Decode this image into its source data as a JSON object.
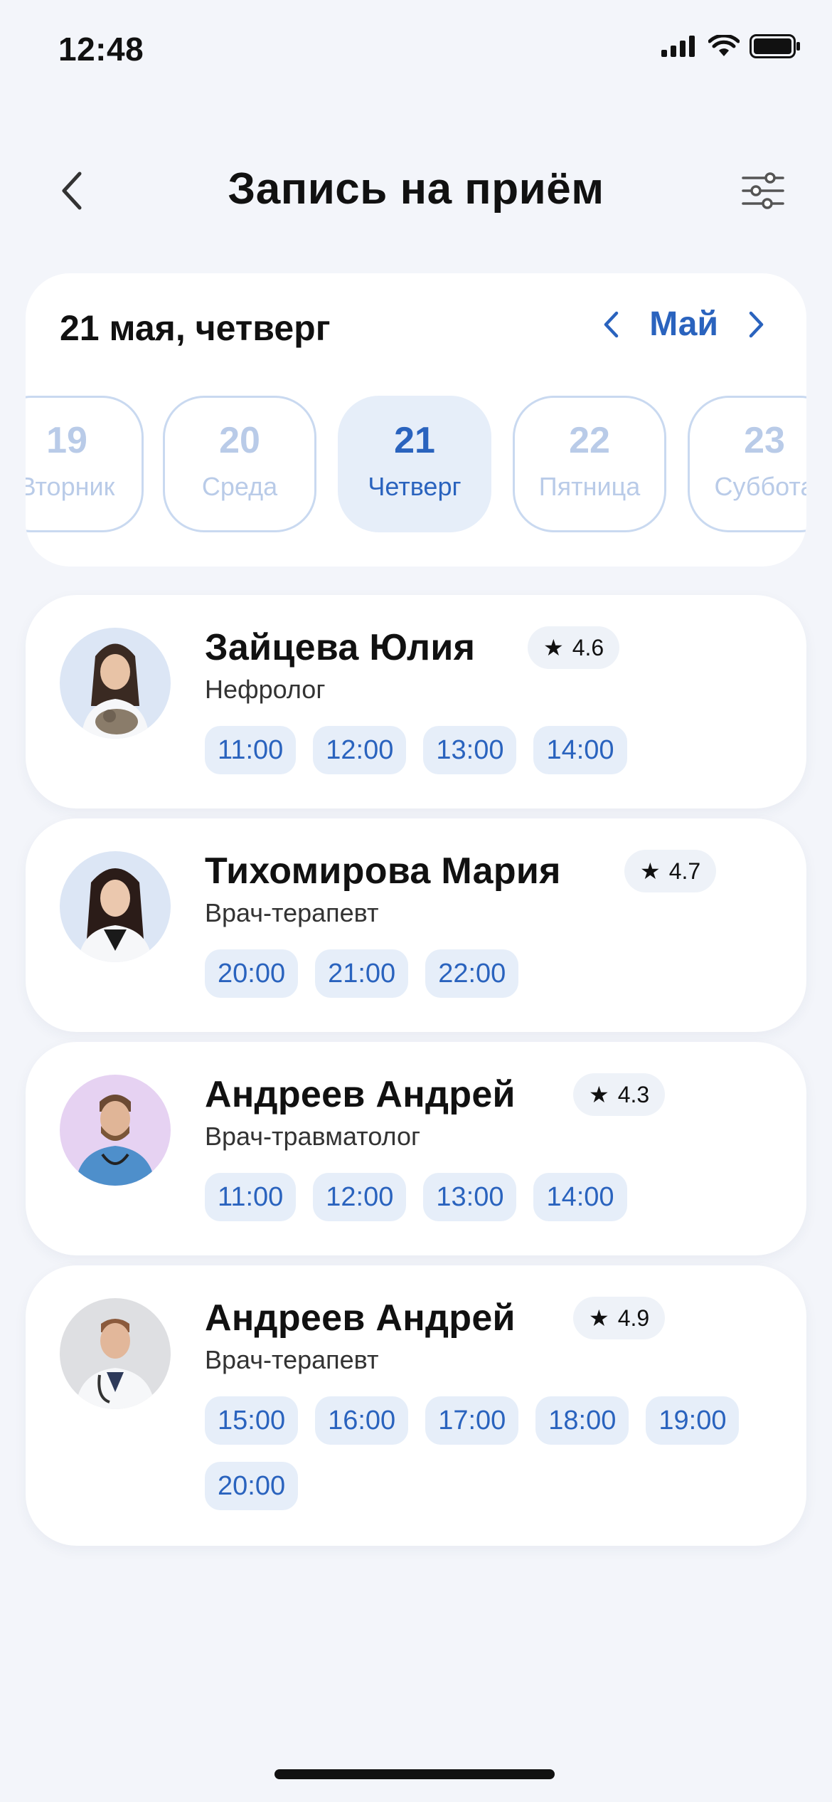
{
  "status_bar": {
    "time": "12:48"
  },
  "header": {
    "title": "Запись на приём"
  },
  "date_picker": {
    "selected_date": "21 мая, четверг",
    "month": "Май",
    "days": [
      {
        "num": "19",
        "weekday": "Вторник"
      },
      {
        "num": "20",
        "weekday": "Среда"
      },
      {
        "num": "21",
        "weekday": "Четверг"
      },
      {
        "num": "22",
        "weekday": "Пятница"
      },
      {
        "num": "23",
        "weekday": "Суббота"
      }
    ]
  },
  "doctors": [
    {
      "name": "Зайцева Юлия",
      "rating": "4.6",
      "specialty": "Нефролог",
      "slots": [
        "11:00",
        "12:00",
        "13:00",
        "14:00"
      ]
    },
    {
      "name": "Тихомирова Мария",
      "rating": "4.7",
      "specialty": "Врач-терапевт",
      "slots": [
        "20:00",
        "21:00",
        "22:00"
      ]
    },
    {
      "name": "Андреев Андрей",
      "rating": "4.3",
      "specialty": "Врач-травматолог",
      "slots": [
        "11:00",
        "12:00",
        "13:00",
        "14:00"
      ]
    },
    {
      "name": "Андреев Андрей",
      "rating": "4.9",
      "specialty": "Врач-терапевт",
      "slots": [
        "15:00",
        "16:00",
        "17:00",
        "18:00",
        "19:00",
        "20:00"
      ]
    }
  ],
  "colors": {
    "accent": "#2A63BE",
    "chip_bg": "#E6EEF9",
    "background": "#F3F5FA"
  }
}
